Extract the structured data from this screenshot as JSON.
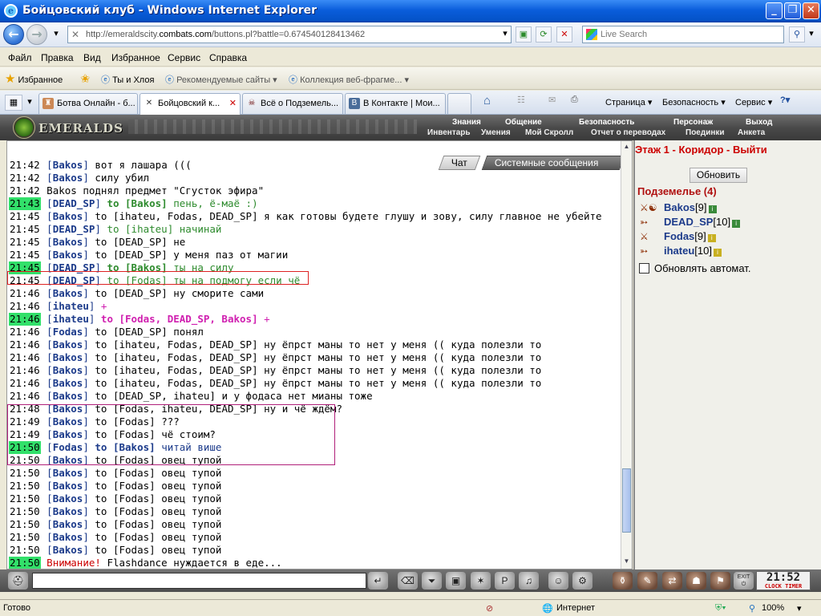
{
  "window": {
    "title": "Бойцовский клуб - Windows Internet Explorer",
    "buttons": [
      "_",
      "❐",
      "✕"
    ]
  },
  "address": {
    "url_prefix": "http://emeraldscity.",
    "url_domain": "combats.com",
    "url_rest": "/buttons.pl?battle=0.674540128413462",
    "search_placeholder": "Live Search"
  },
  "menu": [
    "Файл",
    "Правка",
    "Вид",
    "Избранное",
    "Сервис",
    "Справка"
  ],
  "favorites": {
    "label": "Избранное",
    "items": [
      "Ты и Хлоя",
      "Рекомендуемые сайты ▾",
      "Коллекция веб-фрагме... ▾"
    ]
  },
  "tabs": [
    "Ботва Онлайн - б...",
    "Бойцовский к...",
    "Всё о Подземель...",
    "В Контакте | Мои..."
  ],
  "commands": [
    "Страница ▾",
    "Безопасность ▾",
    "Сервис ▾"
  ],
  "game": {
    "logo": "EMERALDS",
    "topnav": [
      "Знания",
      "Общение",
      "Безопасность",
      "Персонаж",
      "Выход"
    ],
    "subnav": [
      "Инвентарь",
      "Умения",
      "Мой Скролл",
      "Отчет о переводах",
      "Поединки",
      "Анкета"
    ],
    "chat_tabs": {
      "chat": "Чат",
      "system": "Системные сообщения"
    }
  },
  "chat": [
    {
      "time": "21:42",
      "hl": false,
      "nick": "Bakos",
      "to": "",
      "msg": "вот я лашара (((",
      "style": "normal"
    },
    {
      "time": "21:42",
      "hl": false,
      "nick": "Bakos",
      "to": "",
      "msg": "силу убил",
      "style": "normal"
    },
    {
      "time": "21:42",
      "hl": false,
      "nick": "",
      "to": "",
      "msg": "Bakos поднял предмет \"Сгусток эфира\"",
      "style": "sys"
    },
    {
      "time": "21:43",
      "hl": true,
      "nick": "DEAD_SP",
      "to": "to [Bakos]",
      "msg": "пень, ё-маё :)",
      "style": "green-bold"
    },
    {
      "time": "21:45",
      "hl": false,
      "nick": "Bakos",
      "to": "to [ihateu, Fodas, DEAD_SP]",
      "msg": "я как готовы будете глушу и зову, силу главное не убейте",
      "style": "normal"
    },
    {
      "time": "21:45",
      "hl": false,
      "nick": "DEAD_SP",
      "to": "to [ihateu]",
      "msg": "начинай",
      "style": "green"
    },
    {
      "time": "21:45",
      "hl": false,
      "nick": "Bakos",
      "to": "to [DEAD_SP]",
      "msg": "не",
      "style": "normal"
    },
    {
      "time": "21:45",
      "hl": false,
      "nick": "Bakos",
      "to": "to [DEAD_SP]",
      "msg": "у меня паз от магии",
      "style": "normal"
    },
    {
      "time": "21:45",
      "hl": true,
      "nick": "DEAD_SP",
      "to": "to [Bakos]",
      "msg": "ты на силу",
      "style": "green-bold"
    },
    {
      "time": "21:45",
      "hl": false,
      "nick": "DEAD_SP",
      "to": "to [Fodas]",
      "msg": "ты на подмогу если чё",
      "style": "green"
    },
    {
      "time": "21:46",
      "hl": false,
      "nick": "Bakos",
      "to": "to [DEAD_SP]",
      "msg": "ну сморите сами",
      "style": "normal"
    },
    {
      "time": "21:46",
      "hl": false,
      "nick": "ihateu",
      "to": "",
      "msg": "+",
      "style": "mag"
    },
    {
      "time": "21:46",
      "hl": true,
      "nick": "ihateu",
      "to": "to [Fodas, DEAD_SP, Bakos]",
      "msg": "+",
      "style": "mag-bold"
    },
    {
      "time": "21:46",
      "hl": false,
      "nick": "Fodas",
      "to": "to [DEAD_SP]",
      "msg": "понял",
      "style": "normal"
    },
    {
      "time": "21:46",
      "hl": false,
      "nick": "Bakos",
      "to": "to [ihateu, Fodas, DEAD_SP]",
      "msg": "ну ёпрст маны то нет у меня (( куда полезли то",
      "style": "normal"
    },
    {
      "time": "21:46",
      "hl": false,
      "nick": "Bakos",
      "to": "to [ihateu, Fodas, DEAD_SP]",
      "msg": "ну ёпрст маны то нет у меня (( куда полезли то",
      "style": "normal"
    },
    {
      "time": "21:46",
      "hl": false,
      "nick": "Bakos",
      "to": "to [ihateu, Fodas, DEAD_SP]",
      "msg": "ну ёпрст маны то нет у меня (( куда полезли то",
      "style": "normal"
    },
    {
      "time": "21:46",
      "hl": false,
      "nick": "Bakos",
      "to": "to [ihateu, Fodas, DEAD_SP]",
      "msg": "ну ёпрст маны то нет у меня (( куда полезли то",
      "style": "normal"
    },
    {
      "time": "21:46",
      "hl": false,
      "nick": "Bakos",
      "to": "to [DEAD_SP, ihateu]",
      "msg": "и у фодаса нет мианы тоже",
      "style": "normal"
    },
    {
      "time": "21:48",
      "hl": false,
      "nick": "Bakos",
      "to": "to [Fodas, ihateu, DEAD_SP]",
      "msg": "ну и чё ждём?",
      "style": "normal"
    },
    {
      "time": "21:49",
      "hl": false,
      "nick": "Bakos",
      "to": "to [Fodas]",
      "msg": "???",
      "style": "normal"
    },
    {
      "time": "21:49",
      "hl": false,
      "nick": "Bakos",
      "to": "to [Fodas]",
      "msg": "чё стоим?",
      "style": "normal"
    },
    {
      "time": "21:50",
      "hl": true,
      "nick": "Fodas",
      "to": "to [Bakos]",
      "msg": "читай више",
      "style": "blue-bold"
    },
    {
      "time": "21:50",
      "hl": false,
      "nick": "Bakos",
      "to": "to [Fodas]",
      "msg": "овец тупой",
      "style": "normal"
    },
    {
      "time": "21:50",
      "hl": false,
      "nick": "Bakos",
      "to": "to [Fodas]",
      "msg": "овец тупой",
      "style": "normal"
    },
    {
      "time": "21:50",
      "hl": false,
      "nick": "Bakos",
      "to": "to [Fodas]",
      "msg": "овец тупой",
      "style": "normal"
    },
    {
      "time": "21:50",
      "hl": false,
      "nick": "Bakos",
      "to": "to [Fodas]",
      "msg": "овец тупой",
      "style": "normal"
    },
    {
      "time": "21:50",
      "hl": false,
      "nick": "Bakos",
      "to": "to [Fodas]",
      "msg": "овец тупой",
      "style": "normal"
    },
    {
      "time": "21:50",
      "hl": false,
      "nick": "Bakos",
      "to": "to [Fodas]",
      "msg": "овец тупой",
      "style": "normal"
    },
    {
      "time": "21:50",
      "hl": false,
      "nick": "Bakos",
      "to": "to [Fodas]",
      "msg": "овец тупой",
      "style": "normal"
    },
    {
      "time": "21:50",
      "hl": false,
      "nick": "Bakos",
      "to": "to [Fodas]",
      "msg": "овец тупой",
      "style": "normal"
    },
    {
      "time": "21:50",
      "hl": true,
      "nick": "",
      "to": "Внимание!",
      "msg": "Flashdance нуждается в еде...",
      "style": "alert"
    }
  ],
  "panel": {
    "location": "Этаж 1 - Коридор - Выйти",
    "refresh": "Обновить",
    "title": "Подземелье (4)",
    "users": [
      {
        "name": "Bakos",
        "level": "[9]",
        "info": "i",
        "icon": "⚔☯"
      },
      {
        "name": "DEAD_SP",
        "level": "[10]",
        "info": "i",
        "icon": "➳"
      },
      {
        "name": "Fodas",
        "level": "[9]",
        "info": "i",
        "icon": "⚔"
      },
      {
        "name": "ihateu",
        "level": "[10]",
        "info": "i",
        "icon": "➳"
      }
    ],
    "auto_refresh": "Обновлять автомат."
  },
  "bottom": {
    "clock": "21:52",
    "clock_sub": "CLOCK  TIMER",
    "exit": "EXIT"
  },
  "status": {
    "left": "Готово",
    "zone": "Интернет",
    "zoom": "100%"
  }
}
